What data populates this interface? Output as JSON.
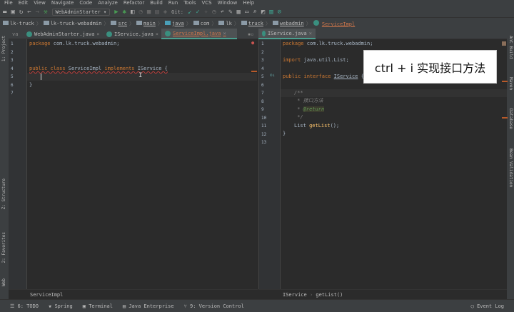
{
  "menu": [
    "File",
    "Edit",
    "View",
    "Navigate",
    "Code",
    "Analyze",
    "Refactor",
    "Build",
    "Run",
    "Tools",
    "VCS",
    "Window",
    "Help"
  ],
  "toolbar": {
    "run_config": "WebAdminStarter",
    "git_label": "Git:"
  },
  "breadcrumb": [
    "lk-truck",
    "lk-truck-webadmin",
    "src",
    "main",
    "java",
    "com",
    "lk",
    "truck",
    "webadmin",
    "ServiceImpl"
  ],
  "tabs_left": [
    {
      "label": "WebAdminStarter.java"
    },
    {
      "label": "IService.java"
    },
    {
      "label": "ServiceImpl.java",
      "active": true
    }
  ],
  "tabs_right": [
    {
      "label": "IService.java",
      "active": true
    }
  ],
  "left_strip": [
    "1: Project",
    "Z: Structure",
    "2: Favorites",
    "Web"
  ],
  "right_strip": [
    "Ant Build",
    "Maven",
    "Database",
    "Bean Validation"
  ],
  "left_editor": {
    "lines": [
      "1",
      "2",
      "3",
      "4",
      "5",
      "6",
      "7"
    ],
    "l1a": "package",
    "l1b": " com.lk.truck.webadmin;",
    "l4a": "public class",
    "l4b": " ServiceImpl ",
    "l4c": "implements",
    "l4d": " IService {",
    "l6": "}"
  },
  "right_editor": {
    "lines": [
      "1",
      "2",
      "3",
      "4",
      "5",
      "6",
      "7",
      "8",
      "9",
      "10",
      "11",
      "12",
      "13"
    ],
    "l1a": "package",
    "l1b": " com.lk.truck.webadmin;",
    "l3a": "import",
    "l3b": " java.util.List;",
    "l5a": "public interface",
    "l5b": "IService",
    "l5c": " {",
    "l7": "/**",
    "l8a": " * ",
    "l8b": "接口方法",
    "l9a": " * ",
    "l9b": "@return",
    "l10": " */",
    "l11a": "List ",
    "l11b": "getList",
    "l11c": "();",
    "l12": "}"
  },
  "overlay_text": "ctrl + i 实现接口方法",
  "footer_left": "ServiceImpl",
  "footer_right": {
    "a": "IService",
    "sep": "›",
    "b": "getList()"
  },
  "bottom_bar": [
    "6: TODO",
    "Spring",
    "Terminal",
    "Java Enterprise",
    "9: Version Control"
  ],
  "event_log": "Event Log"
}
